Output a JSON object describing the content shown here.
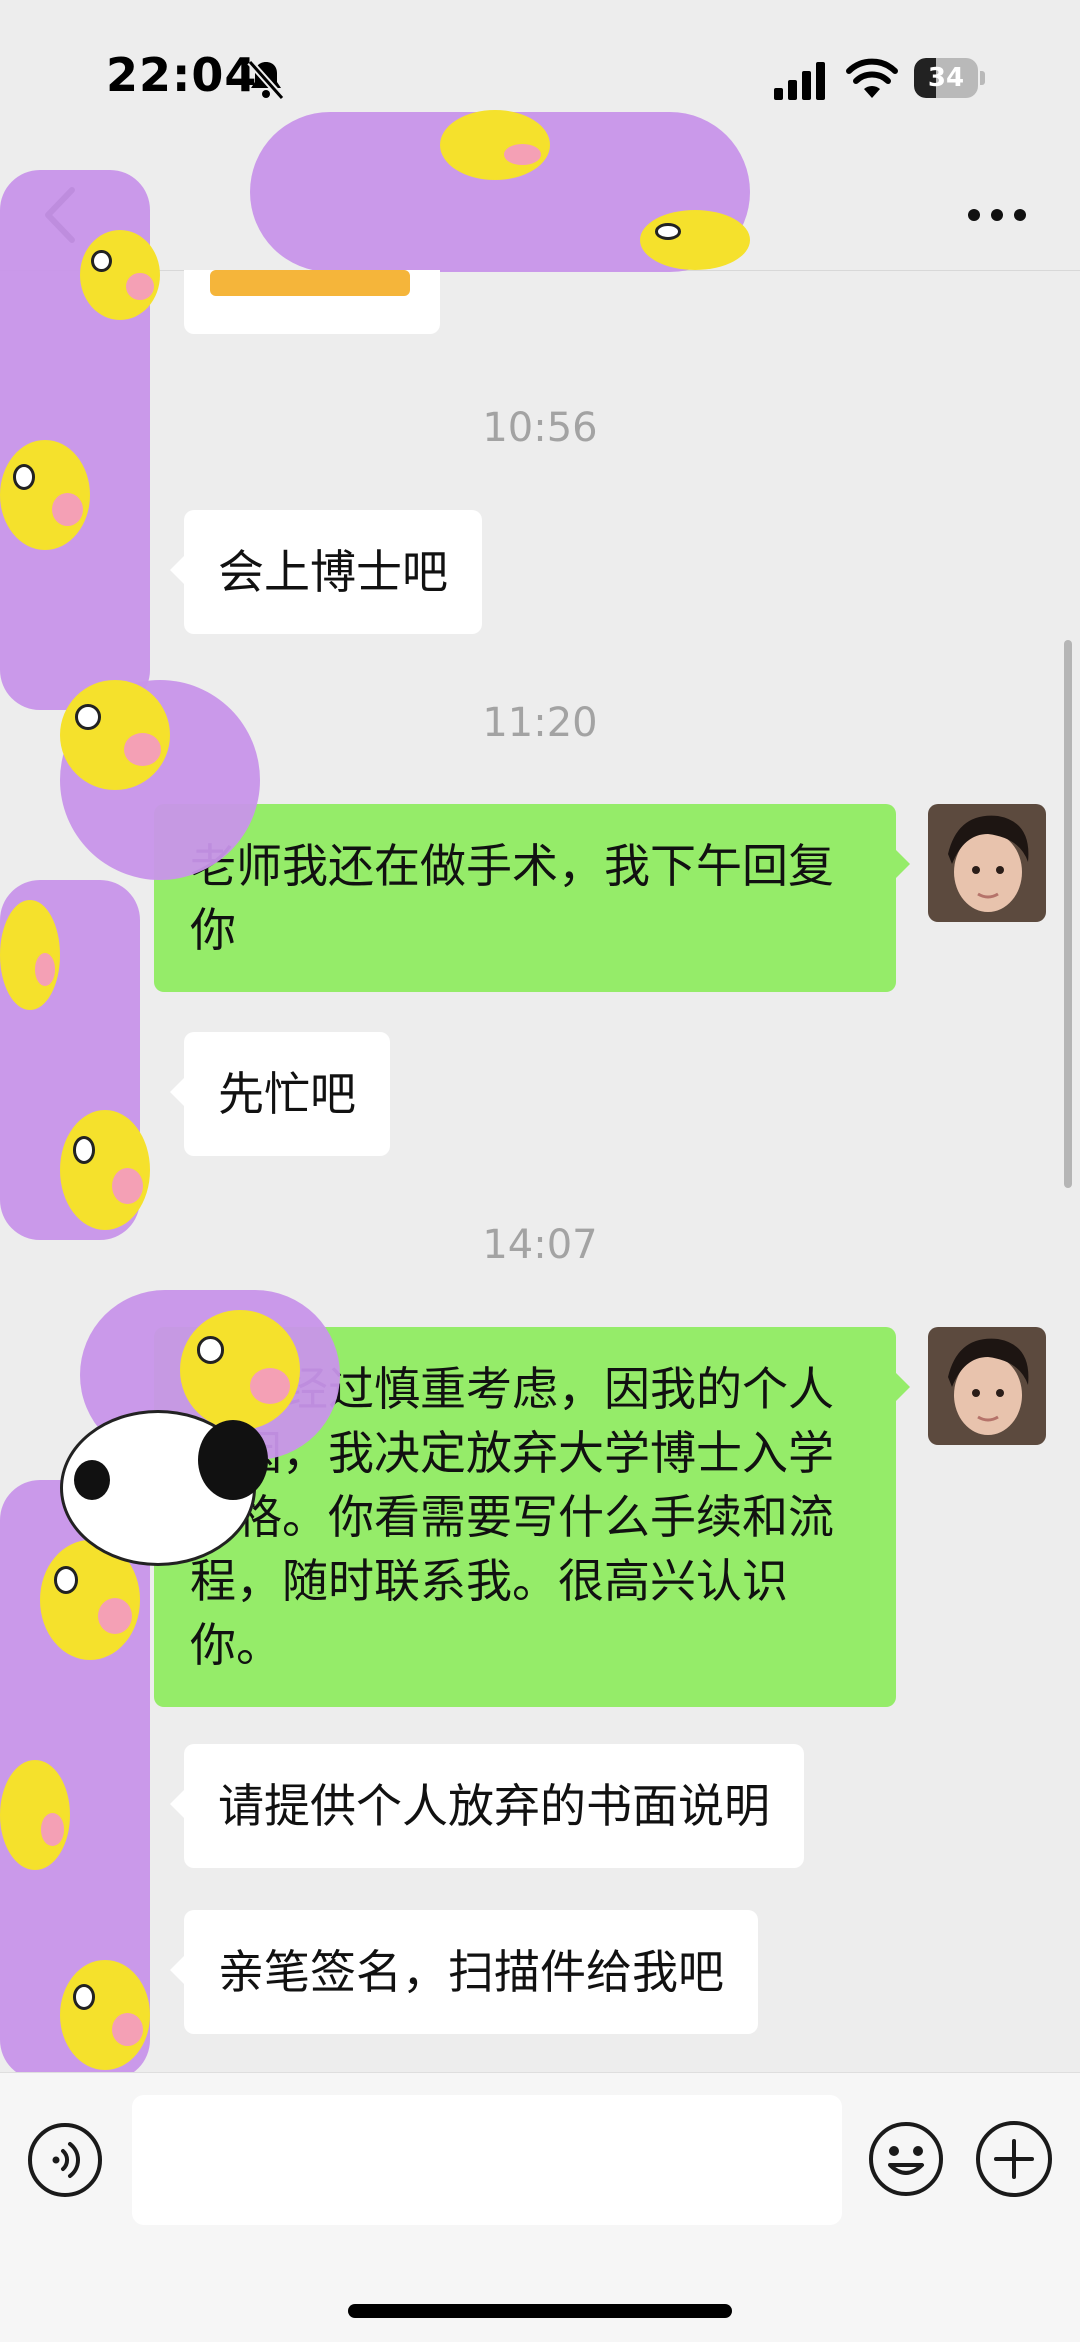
{
  "status_bar": {
    "time": "22:04",
    "battery_level": "34",
    "battery_fraction": 0.34,
    "icons": [
      "mute-bell-icon",
      "cellular-signal-icon",
      "wifi-icon",
      "battery-icon"
    ]
  },
  "header": {
    "icons": [
      "back-arrow-icon",
      "more-options-icon"
    ]
  },
  "messages": [
    {
      "type": "timestamp",
      "text": "10:56"
    },
    {
      "type": "incoming",
      "text": "会上博士吧"
    },
    {
      "type": "timestamp",
      "text": "11:20"
    },
    {
      "type": "outgoing",
      "text": "老师我还在做手术，我下午回复你"
    },
    {
      "type": "incoming",
      "text": "先忙吧"
    },
    {
      "type": "timestamp",
      "text": "14:07"
    },
    {
      "type": "outgoing",
      "text": "，我经过慎重考虑，因我的个人原因，我决定放弃大学博士入学资格。你看需要写什么手续和流程，随时联系我。很高兴认识你。"
    },
    {
      "type": "incoming",
      "text": "请提供个人放弃的书面说明"
    },
    {
      "type": "incoming",
      "text": "亲笔签名，扫描件给我吧"
    }
  ],
  "input_bar": {
    "icons": [
      "voice-icon",
      "emoji-icon",
      "plus-icon"
    ],
    "text_value": ""
  },
  "colors": {
    "background": "#ededed",
    "outgoing_bubble": "#95ec69",
    "incoming_bubble": "#ffffff",
    "sticker_purple": "#c895ea",
    "sticker_yellow": "#f5e12c"
  }
}
